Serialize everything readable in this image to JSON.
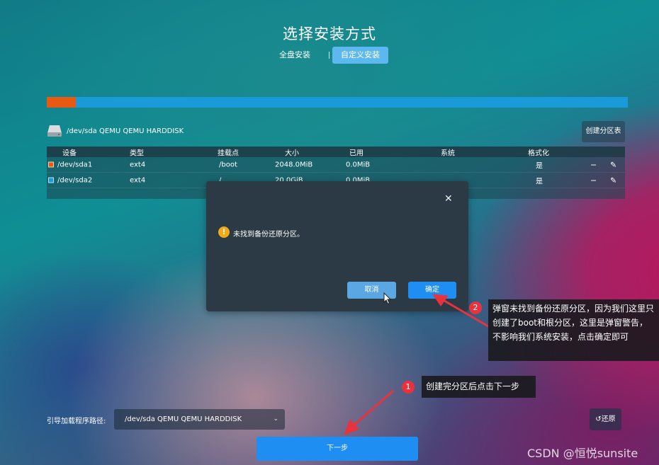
{
  "header": {
    "title": "选择安装方式",
    "tabs": [
      {
        "label": "全盘安装",
        "active": false
      },
      {
        "label": "自定义安装",
        "active": true
      }
    ]
  },
  "partition_bar": {
    "segments": [
      {
        "color": "#e85a12",
        "fraction": 0.05
      },
      {
        "color": "#1a9ad8",
        "fraction": 0.95
      }
    ]
  },
  "disk": {
    "name": "/dev/sda QEMU QEMU HARDDISK",
    "create_table_label": "创建分区表",
    "icon": "hard-disk-icon"
  },
  "table": {
    "columns": [
      "设备",
      "类型",
      "挂载点",
      "大小",
      "已用",
      "系统",
      "格式化"
    ],
    "rows": [
      {
        "swatch": "#e85a12",
        "device": "/dev/sda1",
        "type": "ext4",
        "mount": "/boot",
        "size": "2048.0MiB",
        "used": "0.0MiB",
        "system": "",
        "format": "是"
      },
      {
        "swatch": "#1a9ad8",
        "device": "/dev/sda2",
        "type": "ext4",
        "mount": "/",
        "size": "20.0GiB",
        "used": "0.0MiB",
        "system": "",
        "format": "是"
      }
    ],
    "row_actions": [
      "minus-icon",
      "edit-icon"
    ]
  },
  "dialog": {
    "message": "未找到备份还原分区。",
    "cancel_label": "取消",
    "ok_label": "确定",
    "icons": [
      "close-icon",
      "warning-icon"
    ]
  },
  "annotations": {
    "callout_2_badge": "2",
    "callout_2_text": "弹窗未找到备份还原分区，因为我们这里只创建了boot和根分区，这里是弹窗警告，不影响我们系统安装，点击确定即可",
    "callout_1_badge": "1",
    "callout_1_text": "创建完分区后点击下一步",
    "arrow_color": "#e8333f"
  },
  "footer": {
    "boot_label": "引导加载程序路径:",
    "boot_value": "/dev/sda QEMU QEMU HARDDISK",
    "restore_label": "还原",
    "next_label": "下一步",
    "watermark": "CSDN @恒悦sunsite"
  }
}
